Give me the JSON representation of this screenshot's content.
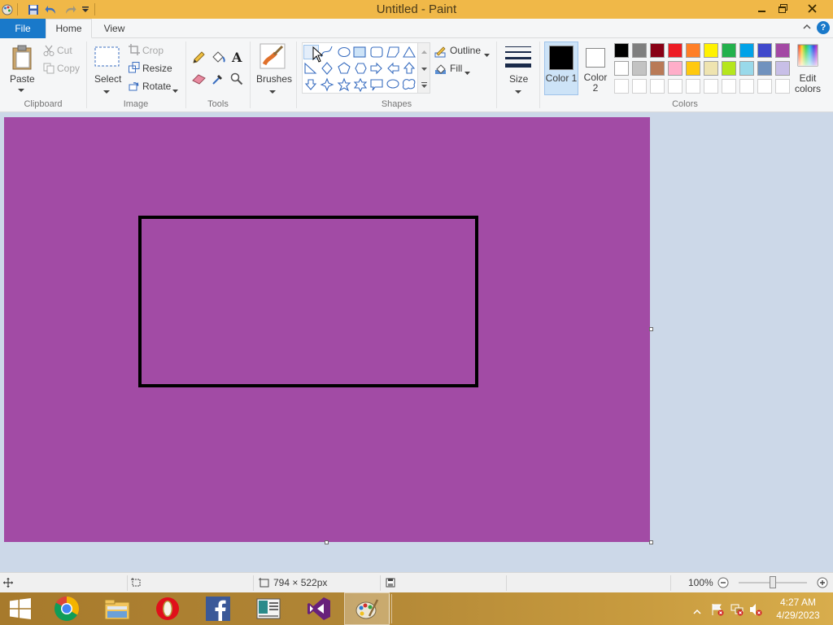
{
  "window": {
    "title": "Untitled - Paint"
  },
  "tabs": {
    "file": "File",
    "home": "Home",
    "view": "View"
  },
  "clipboard": {
    "paste": "Paste",
    "cut": "Cut",
    "copy": "Copy",
    "group": "Clipboard"
  },
  "image": {
    "select": "Select",
    "crop": "Crop",
    "resize": "Resize",
    "rotate": "Rotate",
    "group": "Image"
  },
  "tools": {
    "group": "Tools"
  },
  "brushes": {
    "label": "Brushes"
  },
  "shapes": {
    "outline": "Outline",
    "fill": "Fill",
    "group": "Shapes"
  },
  "size": {
    "label": "Size"
  },
  "colors": {
    "color1_label": "Color 1",
    "color2_label": "Color 2",
    "color1": "#000000",
    "color2": "#ffffff",
    "edit_line1": "Edit",
    "edit_line2": "colors",
    "group": "Colors",
    "palette_row1": [
      "#000000",
      "#7f7f7f",
      "#880015",
      "#ed1c24",
      "#ff7f27",
      "#fff200",
      "#22b14c",
      "#00a2e8",
      "#3f48cc",
      "#a349a4"
    ],
    "palette_row2": [
      "#ffffff",
      "#c3c3c3",
      "#b97a57",
      "#ffaec9",
      "#ffc90e",
      "#efe4b0",
      "#b5e61d",
      "#99d9ea",
      "#7092be",
      "#c8bfe7"
    ]
  },
  "canvas": {
    "background": "#a24ba5"
  },
  "status": {
    "dimensions": "794 × 522px",
    "zoom": "100%"
  },
  "taskbar": {
    "time": "4:27 AM",
    "date": "4/29/2023"
  }
}
